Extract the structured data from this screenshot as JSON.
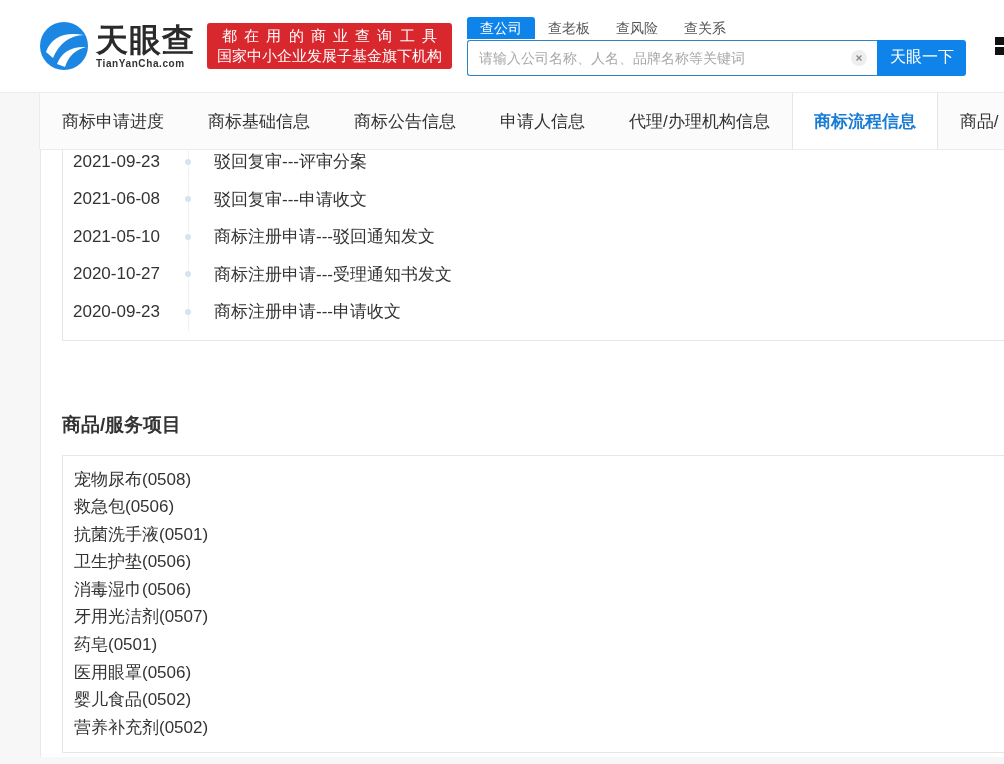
{
  "header": {
    "logo": {
      "name": "天眼查",
      "domain": "TianYanCha.com"
    },
    "slogan": {
      "line_1": "都在用的商业查询工具",
      "line_2": "国家中小企业发展子基金旗下机构"
    },
    "search": {
      "tabs": [
        {
          "label": "查公司",
          "selected": true
        },
        {
          "label": "查老板",
          "selected": false
        },
        {
          "label": "查风险",
          "selected": false
        },
        {
          "label": "查关系",
          "selected": false
        }
      ],
      "placeholder": "请输入公司名称、人名、品牌名称等关键词",
      "button": "天眼一下"
    }
  },
  "nav_tabs": [
    {
      "label": "商标申请进度",
      "selected": false
    },
    {
      "label": "商标基础信息",
      "selected": false
    },
    {
      "label": "商标公告信息",
      "selected": false
    },
    {
      "label": "申请人信息",
      "selected": false
    },
    {
      "label": "代理/办理机构信息",
      "selected": false
    },
    {
      "label": "商标流程信息",
      "selected": true
    },
    {
      "label": "商品/",
      "selected": false
    }
  ],
  "timeline": [
    {
      "date": "2021-09-23",
      "event": "驳回复审---评审分案"
    },
    {
      "date": "2021-06-08",
      "event": "驳回复审---申请收文"
    },
    {
      "date": "2021-05-10",
      "event": "商标注册申请---驳回通知发文"
    },
    {
      "date": "2020-10-27",
      "event": "商标注册申请---受理通知书发文"
    },
    {
      "date": "2020-09-23",
      "event": "商标注册申请---申请收文"
    }
  ],
  "goods_services": {
    "title": "商品/服务项目",
    "items": [
      "宠物尿布(0508)",
      "救急包(0506)",
      "抗菌洗手液(0501)",
      "卫生护垫(0506)",
      "消毒湿巾(0506)",
      "牙用光洁剂(0507)",
      "药皂(0501)",
      "医用眼罩(0506)",
      "婴儿食品(0502)",
      "营养补充剂(0502)"
    ]
  }
}
